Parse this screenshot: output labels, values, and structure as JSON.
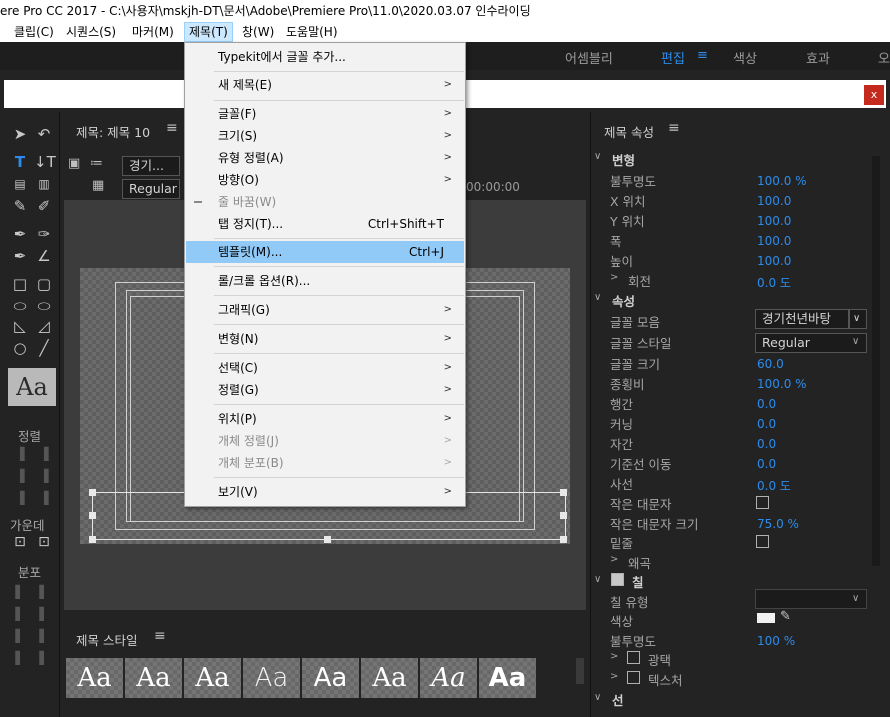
{
  "titlebar": {
    "text": "ere Pro CC 2017 - C:\\사용자\\mskjh-DT\\문서\\Adobe\\Premiere Pro\\11.0\\2020.03.07 인수라이딩"
  },
  "menubar": [
    "클립(C)",
    "시퀀스(S)",
    "마커(M)",
    "제목(T)",
    "창(W)",
    "도움말(H)"
  ],
  "workspaces": {
    "assembly": "어셈블리",
    "edit": "편집",
    "color": "색상",
    "effects": "효과",
    "audio": "오"
  },
  "close_label": "x",
  "editor": {
    "tab": "제목: 제목 10",
    "font_combo": "경기...",
    "style_combo": "Regular",
    "timecode": "00:00:00",
    "aa": "Aa"
  },
  "tool_sections": {
    "align": "정렬",
    "center": "가운데",
    "distribute": "분포"
  },
  "styles": {
    "title": "제목 스타일",
    "swatch": "Aa"
  },
  "props": {
    "title": "제목 속성",
    "transform": "변형",
    "rows1": [
      {
        "label": "불투명도",
        "value": "100.0 %"
      },
      {
        "label": "X 위치",
        "value": "100.0"
      },
      {
        "label": "Y 위치",
        "value": "100.0"
      },
      {
        "label": "폭",
        "value": "100.0"
      },
      {
        "label": "높이",
        "value": "100.0"
      }
    ],
    "rotation": "회전",
    "rotation_value": "0.0 도",
    "attributes": "속성",
    "font_family": "글꼴 모음",
    "font_family_value": "경기천년바탕",
    "font_style": "글꼴 스타일",
    "font_style_value": "Regular",
    "rows2": [
      {
        "label": "글꼴 크기",
        "value": "60.0"
      },
      {
        "label": "종횡비",
        "value": "100.0 %"
      },
      {
        "label": "행간",
        "value": "0.0"
      },
      {
        "label": "커닝",
        "value": "0.0"
      },
      {
        "label": "자간",
        "value": "0.0"
      },
      {
        "label": "기준선 이동",
        "value": "0.0"
      },
      {
        "label": "사선",
        "value": "0.0 도"
      }
    ],
    "small_caps": "작은 대문자",
    "small_caps_size": "작은 대문자 크기",
    "small_caps_size_value": "75.0 %",
    "underline": "밑줄",
    "distort": "왜곡",
    "fill": "칠",
    "fill_type": "칠 유형",
    "color": "색상",
    "opacity": "불투명도",
    "opacity_value": "100 %",
    "sheen": "광택",
    "texture": "텍스처",
    "stroke": "선"
  },
  "menu": {
    "items": [
      {
        "label": "Typekit에서 글꼴 추가...",
        "shortcut": "",
        "arrow": false,
        "disabled": false
      },
      {
        "label": "새 제목(E)",
        "shortcut": "",
        "arrow": true,
        "disabled": false
      },
      {
        "label": "글꼴(F)",
        "shortcut": "",
        "arrow": true,
        "disabled": false
      },
      {
        "label": "크기(S)",
        "shortcut": "",
        "arrow": true,
        "disabled": false
      },
      {
        "label": "유형 정렬(A)",
        "shortcut": "",
        "arrow": true,
        "disabled": false
      },
      {
        "label": "방향(O)",
        "shortcut": "",
        "arrow": true,
        "disabled": false
      },
      {
        "label": "줄 바꿈(W)",
        "shortcut": "",
        "arrow": false,
        "disabled": true
      },
      {
        "label": "탭 정지(T)...",
        "shortcut": "Ctrl+Shift+T",
        "arrow": false,
        "disabled": false
      },
      {
        "label": "템플릿(M)...",
        "shortcut": "Ctrl+J",
        "arrow": false,
        "disabled": false
      },
      {
        "label": "롤/크롤 옵션(R)...",
        "shortcut": "",
        "arrow": false,
        "disabled": false
      },
      {
        "label": "그래픽(G)",
        "shortcut": "",
        "arrow": true,
        "disabled": false
      },
      {
        "label": "변형(N)",
        "shortcut": "",
        "arrow": true,
        "disabled": false
      },
      {
        "label": "선택(C)",
        "shortcut": "",
        "arrow": true,
        "disabled": false
      },
      {
        "label": "정렬(G)",
        "shortcut": "",
        "arrow": true,
        "disabled": false
      },
      {
        "label": "위치(P)",
        "shortcut": "",
        "arrow": true,
        "disabled": false
      },
      {
        "label": "개체 정렬(J)",
        "shortcut": "",
        "arrow": true,
        "disabled": true
      },
      {
        "label": "개체 분포(B)",
        "shortcut": "",
        "arrow": true,
        "disabled": true
      },
      {
        "label": "보기(V)",
        "shortcut": "",
        "arrow": true,
        "disabled": false
      }
    ]
  },
  "colors": {
    "accent": "#2d8ceb",
    "highlight": "#91c9f7"
  }
}
